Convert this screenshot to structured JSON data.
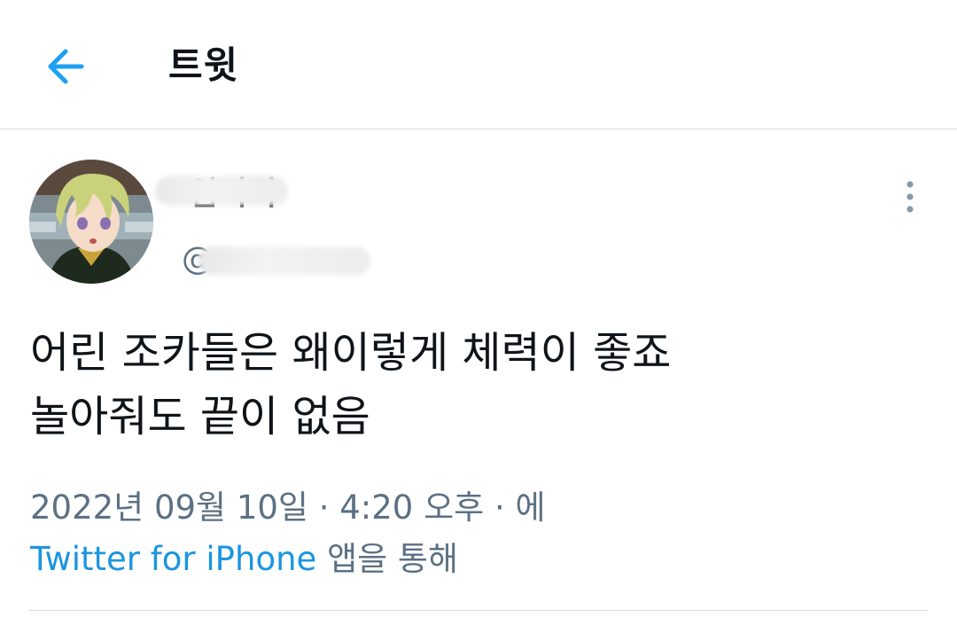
{
  "header": {
    "title": "트윗",
    "back_icon": "arrow-left-icon",
    "accent_color": "#1da1f2"
  },
  "tweet": {
    "display_name": "임지디",
    "handle": "@",
    "more_icon": "more-vertical-icon",
    "text": "어린 조카들은 왜이렇게 체력이 좋죠\n놀아줘도 끝이 없음",
    "timestamp": "2022년 09월 10일 · 4:20 오후 · 에",
    "source_app": "Twitter for iPhone",
    "source_suffix": " 앱을 통해",
    "link_color": "#1b95e0",
    "meta_color": "#5b7083"
  }
}
